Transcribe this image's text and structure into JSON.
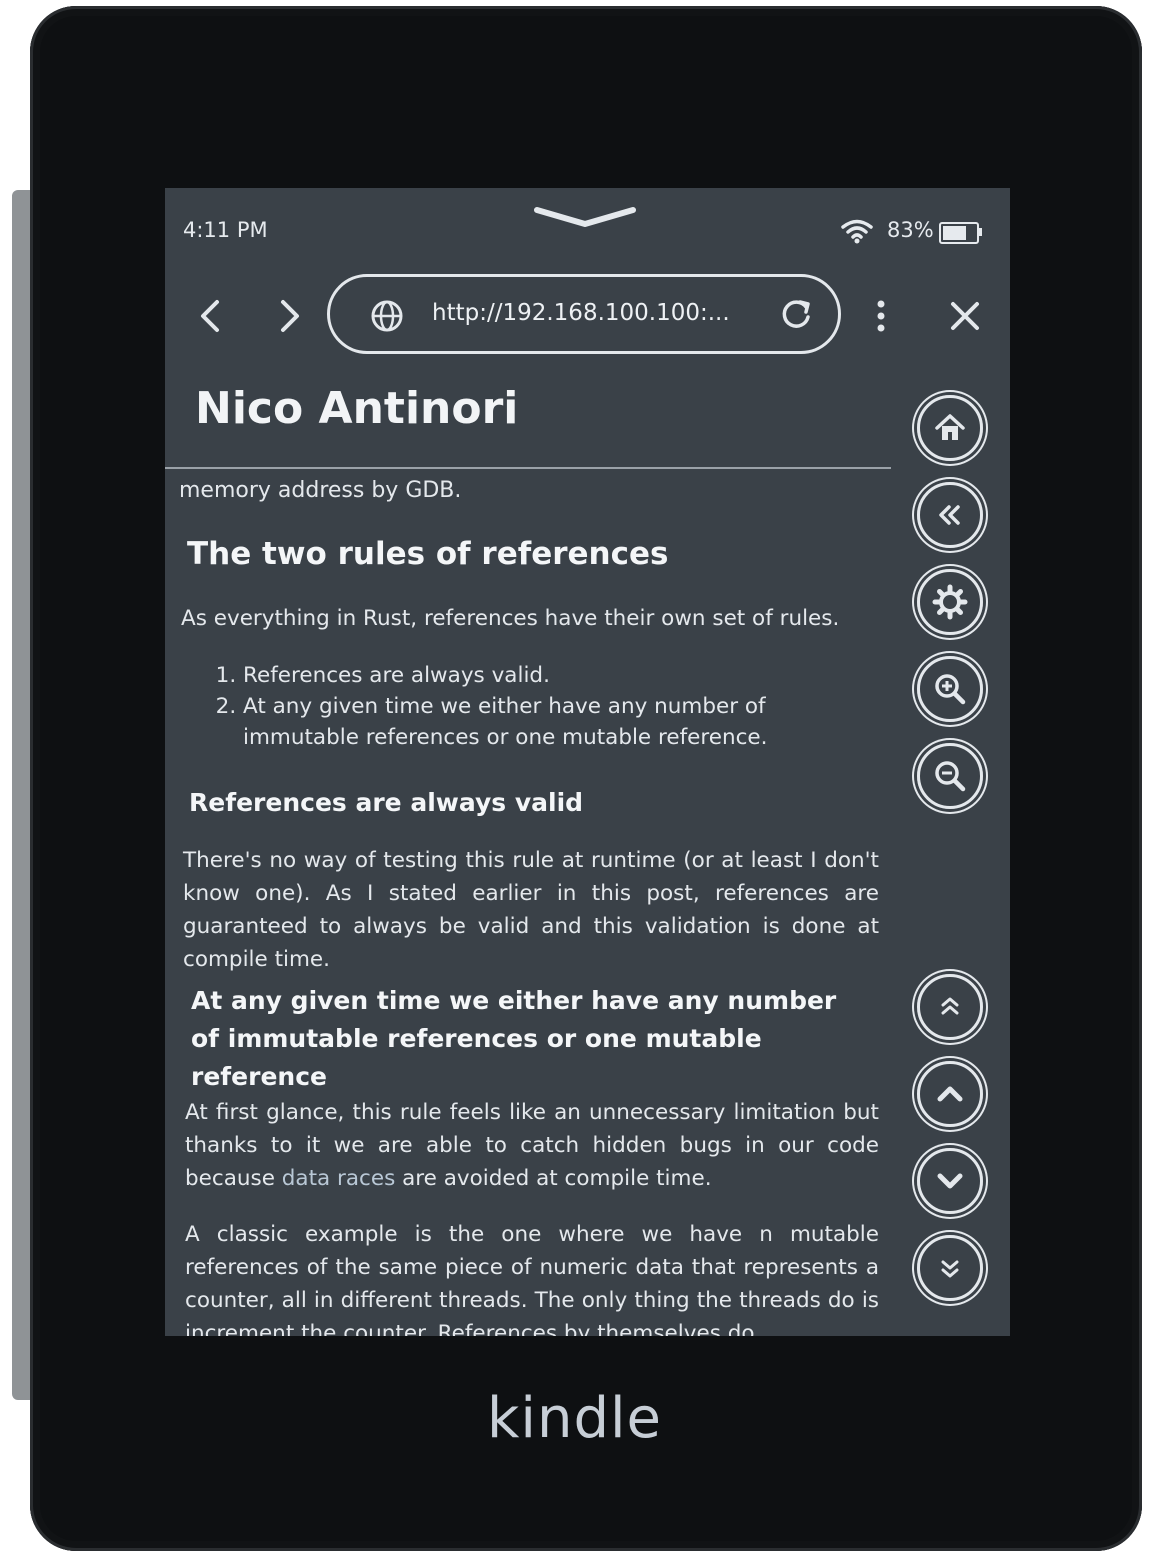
{
  "device": {
    "brand": "kindle"
  },
  "status_bar": {
    "time": "4:11 PM",
    "battery": "83%",
    "battery_level": 0.83
  },
  "browser": {
    "url": "http://192.168.100.100:..."
  },
  "page": {
    "site_title": "Nico Antinori",
    "partial_line": "memory address by GDB.",
    "heading": "The two rules of references",
    "intro": "As everything in Rust, references have their own set of rules.",
    "rules": [
      "References are always valid.",
      "At any given time we either have any number of immutable references or one mutable reference."
    ],
    "subheading_1": "References are always valid",
    "para_1": "There's no way of testing this rule at runtime (or at least I don't know one). As I stated earlier in this post, references are guaranteed to always be valid and this validation is done at compile time.",
    "subheading_2": "At any given time we either have any number of immutable references or one mutable reference",
    "para_2_before": "At first glance, this rule feels like an unnecessary limitation but thanks to it we are able to catch hidden bugs in our code because ",
    "para_2_link": "data races",
    "para_2_after": " are avoided at compile time.",
    "para_3": "A classic example is the one where we have n mutable references of the same piece of numeric data that represents a counter, all in different threads. The only thing the threads do is increment the counter. References by themselves do"
  },
  "icons": {
    "back": "chevron-left-icon",
    "forward": "chevron-right-icon",
    "globe": "globe-icon",
    "reload": "reload-icon",
    "menu": "more-vertical-icon",
    "close": "close-icon",
    "home": "home-icon",
    "back_history": "double-chevron-left-icon",
    "settings": "gear-icon",
    "zoom_in": "zoom-in-icon",
    "zoom_out": "zoom-out-icon",
    "page_top": "double-chevron-up-icon",
    "scroll_up": "chevron-up-icon",
    "scroll_down": "chevron-down-icon",
    "page_bottom": "double-chevron-down-icon"
  }
}
